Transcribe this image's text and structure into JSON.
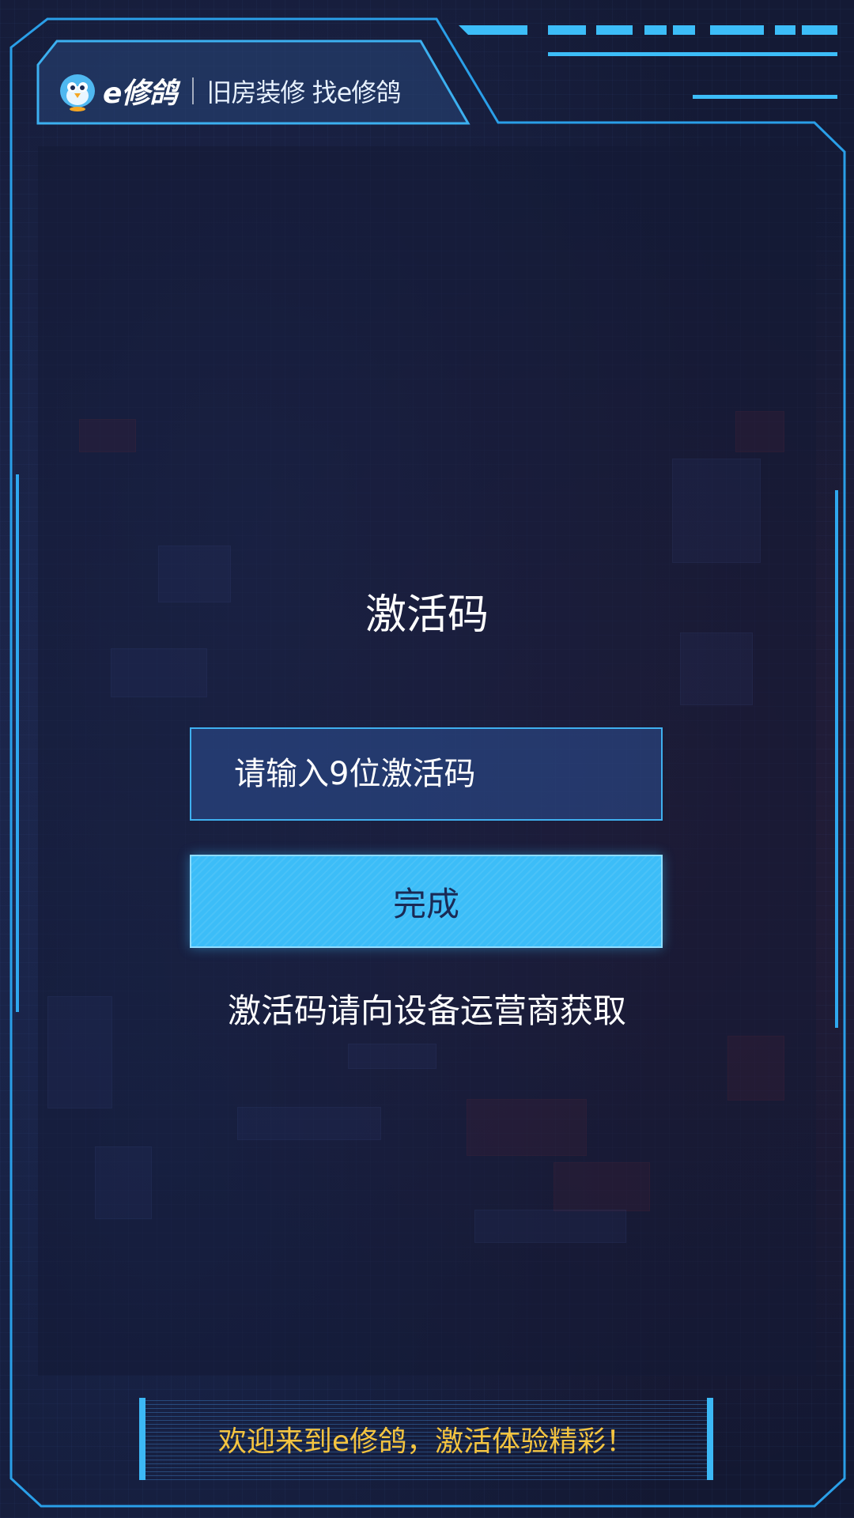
{
  "header": {
    "brand_name": "e修鸽",
    "slogan": "旧房装修 找e修鸽"
  },
  "activation": {
    "title": "激活码",
    "input_placeholder": "请输入9位激活码",
    "input_value": "",
    "submit_label": "完成",
    "hint": "激活码请向设备运营商获取"
  },
  "footer": {
    "welcome": "欢迎来到e修鸽，激活体验精彩！"
  },
  "colors": {
    "accent": "#3cbdf8",
    "background": "#141a33",
    "footer_text": "#f4c440",
    "frame": "#2a9fe8"
  }
}
